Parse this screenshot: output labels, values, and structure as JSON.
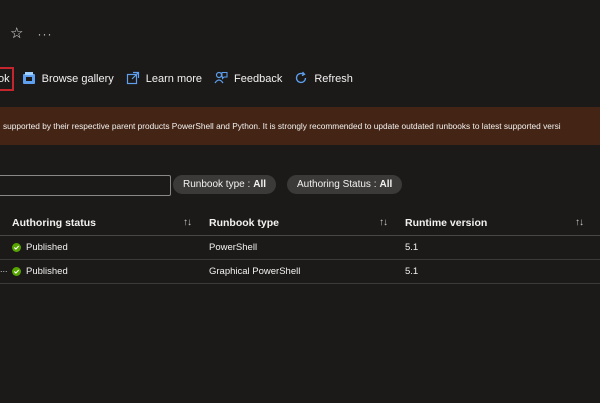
{
  "header": {
    "favorite_icon": "star-icon",
    "more_icon": "ellipsis-icon",
    "more_label": "···"
  },
  "toolbar": {
    "items": [
      {
        "label": "ok",
        "icon": "none"
      },
      {
        "label": "Browse gallery",
        "icon": "gallery-icon"
      },
      {
        "label": "Learn more",
        "icon": "external-link-icon"
      },
      {
        "label": "Feedback",
        "icon": "feedback-icon"
      },
      {
        "label": "Refresh",
        "icon": "refresh-icon"
      }
    ]
  },
  "banner": {
    "text": "supported by their respective parent products PowerShell and Python. It is strongly recommended to update outdated runbooks to latest supported versi",
    "color": "#442515"
  },
  "filters": {
    "search_value": "",
    "runbook_type": {
      "label": "Runbook type :",
      "value": "All"
    },
    "authoring_status": {
      "label": "Authoring Status :",
      "value": "All"
    }
  },
  "table": {
    "columns": [
      "Authoring status",
      "Runbook type",
      "Runtime version"
    ],
    "sort_icon": "↑↓",
    "rows": [
      {
        "status": "Published",
        "type": "PowerShell",
        "runtime": "5.1",
        "lead": ""
      },
      {
        "status": "Published",
        "type": "Graphical PowerShell",
        "runtime": "5.1",
        "lead": "..."
      }
    ]
  },
  "colors": {
    "background": "#1b1a19",
    "accent_border": "#c4262e",
    "success": "#57a300"
  }
}
